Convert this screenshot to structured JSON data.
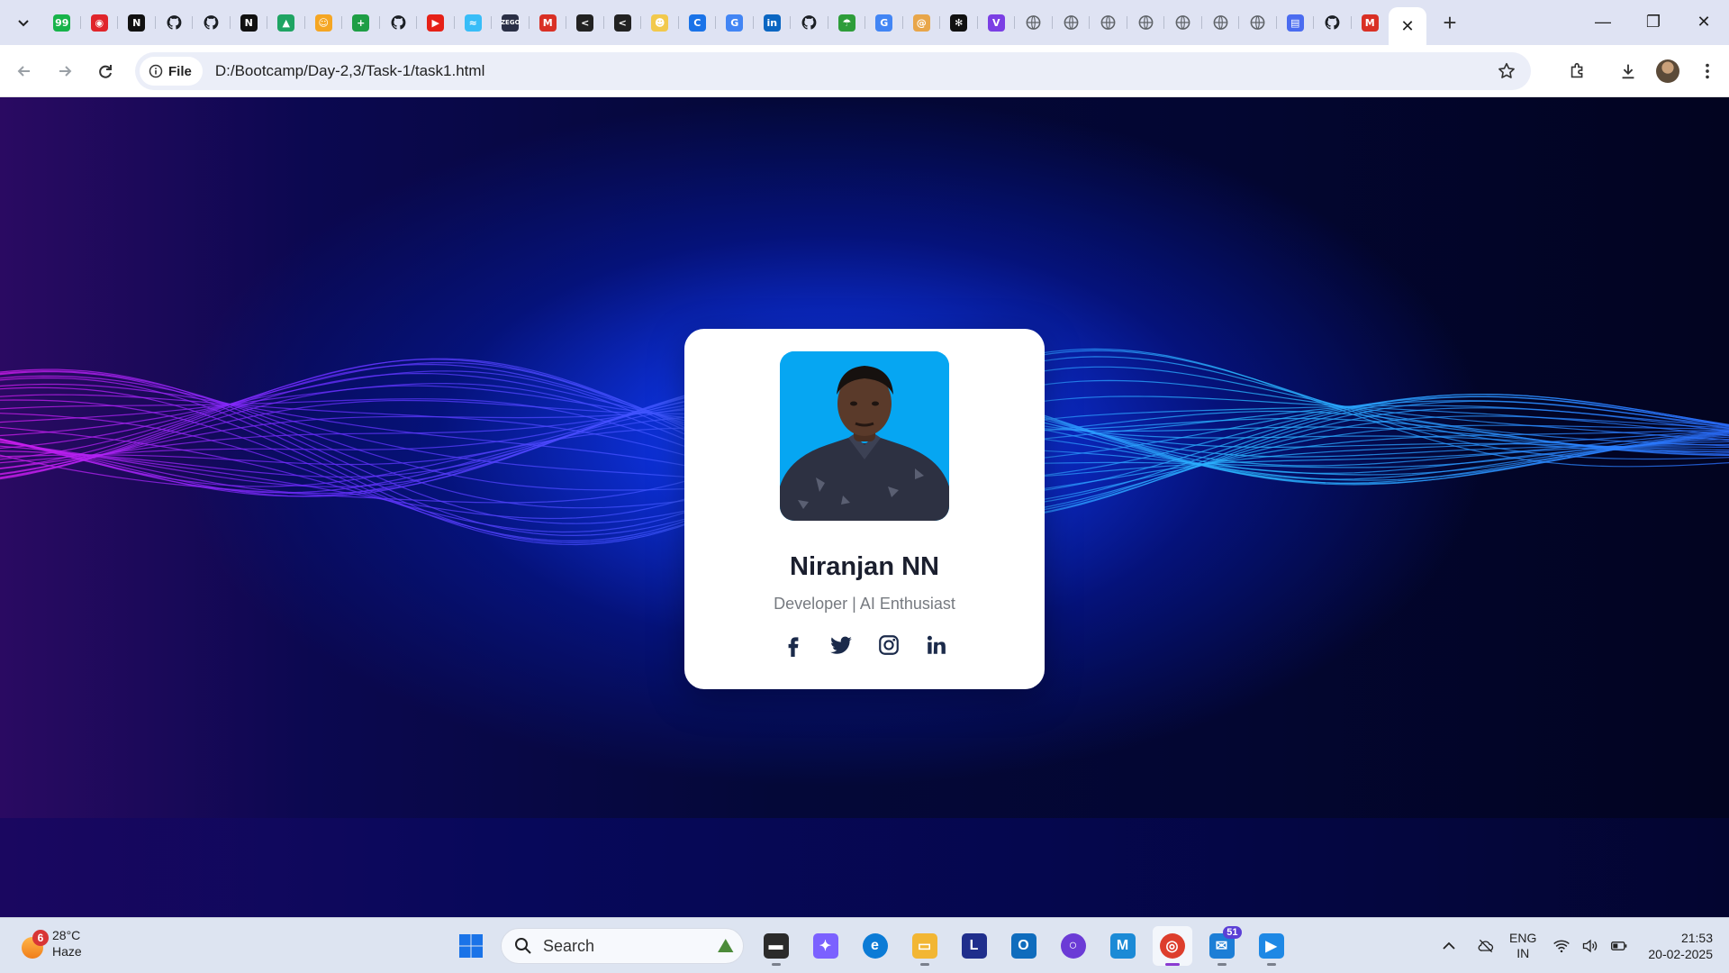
{
  "browser": {
    "pinned_tabs": [
      {
        "icon": "counter-icon",
        "glyph": "99",
        "color": "#17b34a"
      },
      {
        "icon": "record-icon",
        "glyph": "◉",
        "color": "#e0252b"
      },
      {
        "icon": "notion-icon",
        "glyph": "N",
        "color": "#111111"
      },
      {
        "icon": "github-icon",
        "glyph": "",
        "color": "#111111"
      },
      {
        "icon": "github-icon",
        "glyph": "",
        "color": "#111111"
      },
      {
        "icon": "notion-icon",
        "glyph": "N",
        "color": "#111111"
      },
      {
        "icon": "google-drive-icon",
        "glyph": "▲",
        "color": "#1fa463"
      },
      {
        "icon": "emoji-icon",
        "glyph": "☺",
        "color": "#f5a623"
      },
      {
        "icon": "sheets-plus-icon",
        "glyph": "+",
        "color": "#1e9e45"
      },
      {
        "icon": "github-icon",
        "glyph": "",
        "color": "#111111"
      },
      {
        "icon": "youtube-icon",
        "glyph": "▶",
        "color": "#e62117"
      },
      {
        "icon": "tailwind-icon",
        "glyph": "≈",
        "color": "#38bdf8"
      },
      {
        "icon": "zego-icon",
        "glyph": "ZEGO",
        "color": "#2a2f45"
      },
      {
        "icon": "gmail-icon",
        "glyph": "M",
        "color": "#d93025"
      },
      {
        "icon": "tool-icon",
        "glyph": "<",
        "color": "#222222"
      },
      {
        "icon": "tool-icon",
        "glyph": "<",
        "color": "#222222"
      },
      {
        "icon": "avatar-icon",
        "glyph": "☻",
        "color": "#f2c94c"
      },
      {
        "icon": "c-icon",
        "glyph": "C",
        "color": "#1a73e8"
      },
      {
        "icon": "google-icon",
        "glyph": "G",
        "color": "#4285f4"
      },
      {
        "icon": "linkedin-icon",
        "glyph": "in",
        "color": "#0a66c2"
      },
      {
        "icon": "github-icon",
        "glyph": "",
        "color": "#111111"
      },
      {
        "icon": "umbrella-icon",
        "glyph": "☂",
        "color": "#2e9d3a"
      },
      {
        "icon": "google-icon",
        "glyph": "G",
        "color": "#4285f4"
      },
      {
        "icon": "spiral-icon",
        "glyph": "@",
        "color": "#e8a64a"
      },
      {
        "icon": "openai-icon",
        "glyph": "✻",
        "color": "#111111"
      },
      {
        "icon": "v-icon",
        "glyph": "V",
        "color": "#7b3fe4"
      },
      {
        "icon": "globe-icon",
        "glyph": "",
        "color": "#555555"
      },
      {
        "icon": "globe-icon",
        "glyph": "",
        "color": "#555555"
      },
      {
        "icon": "globe-icon",
        "glyph": "",
        "color": "#555555"
      },
      {
        "icon": "globe-icon",
        "glyph": "",
        "color": "#555555"
      },
      {
        "icon": "globe-icon",
        "glyph": "",
        "color": "#555555"
      },
      {
        "icon": "globe-icon",
        "glyph": "",
        "color": "#555555"
      },
      {
        "icon": "globe-icon",
        "glyph": "",
        "color": "#555555"
      },
      {
        "icon": "app-icon",
        "glyph": "▤",
        "color": "#4b6cf0"
      },
      {
        "icon": "github-icon",
        "glyph": "",
        "color": "#111111"
      },
      {
        "icon": "gmail-icon",
        "glyph": "M",
        "color": "#d93025"
      }
    ],
    "active_tab_close": "✕",
    "new_tab": "+",
    "window": {
      "minimize": "—",
      "restore": "❐",
      "close": "✕"
    },
    "chip_label": "File",
    "url": "D:/Bootcamp/Day-2,3/Task-1/task1.html"
  },
  "profile_card": {
    "name": "Niranjan NN",
    "role": "Developer | AI Enthusiast",
    "socials": [
      "facebook",
      "twitter",
      "instagram",
      "linkedin"
    ]
  },
  "taskbar": {
    "weather": {
      "temp": "28°C",
      "condition": "Haze",
      "badge": "6"
    },
    "search_label": "Search",
    "apps": [
      {
        "icon": "file-explorer-dark-icon",
        "glyph": "▬",
        "color": "#2b2b2b"
      },
      {
        "icon": "copilot-icon",
        "glyph": "✦",
        "color": "#7b61ff"
      },
      {
        "icon": "edge-icon",
        "glyph": "e",
        "color": "#0b7bd6"
      },
      {
        "icon": "folder-icon",
        "glyph": "▭",
        "color": "#f2b634"
      },
      {
        "icon": "l-app-icon",
        "glyph": "L",
        "color": "#1f2e8c"
      },
      {
        "icon": "outlook-icon",
        "glyph": "O",
        "color": "#0f6cbd"
      },
      {
        "icon": "circle-app-icon",
        "glyph": "○",
        "color": "#6b3bd6"
      },
      {
        "icon": "m365-icon",
        "glyph": "M",
        "color": "#1b8ad6"
      },
      {
        "icon": "chrome-icon",
        "glyph": "◎",
        "color": "#dd3e2c"
      },
      {
        "icon": "messenger-icon",
        "glyph": "✉",
        "color": "#1c7ed6"
      },
      {
        "icon": "zoom-icon",
        "glyph": "▶",
        "color": "#1e88e5"
      }
    ],
    "messenger_badge": "51",
    "lang": {
      "line1": "ENG",
      "line2": "IN"
    },
    "time": "21:53",
    "date": "20-02-2025"
  }
}
